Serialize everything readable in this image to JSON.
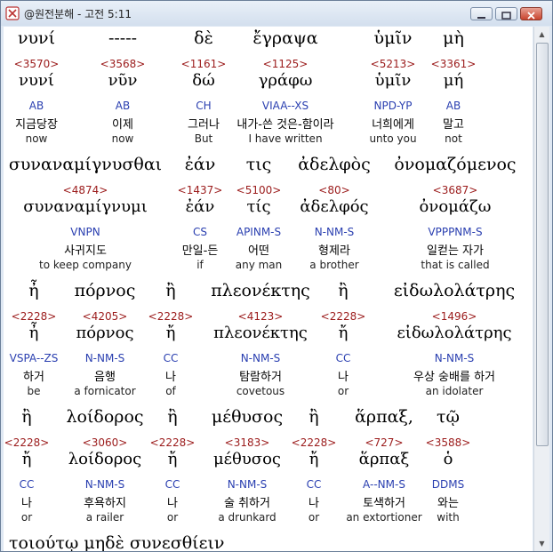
{
  "window": {
    "title": "@원전분해 - 고전 5:11"
  },
  "rows": [
    [
      {
        "word": "νυνί",
        "num": "<3570>",
        "lemma": "νυνί",
        "parse": "AB",
        "kor": "지금당장",
        "eng": "now"
      },
      {
        "word": "-----",
        "num": "<3568>",
        "lemma": "νῦν",
        "parse": "AB",
        "kor": "이제",
        "eng": "now"
      },
      {
        "word": "δὲ",
        "num": "<1161>",
        "lemma": "δώ",
        "parse": "CH",
        "kor": "그러나",
        "eng": "But"
      },
      {
        "word": "ἔγραψα",
        "num": "<1125>",
        "lemma": "γράφω",
        "parse": "VIAA--XS",
        "kor": "내가-쓴 것은-함이라",
        "eng": "I have written"
      },
      {
        "word": "ὑμῖν",
        "num": "<5213>",
        "lemma": "ὑμῖν",
        "parse": "NPD-YP",
        "kor": "너희에게",
        "eng": "unto you"
      },
      {
        "word": "μὴ",
        "num": "<3361>",
        "lemma": "μή",
        "parse": "AB",
        "kor": "말고",
        "eng": "not"
      }
    ],
    [
      {
        "word": "συναναμίγνυσθαι",
        "num": "<4874>",
        "lemma": "συναναμίγνυμι",
        "parse": "VNPN",
        "kor": "사귀지도",
        "eng": "to keep company"
      },
      {
        "word": "ἐάν",
        "num": "<1437>",
        "lemma": "ἐάν",
        "parse": "CS",
        "kor": "만일-든",
        "eng": "if"
      },
      {
        "word": "τις",
        "num": "<5100>",
        "lemma": "τίς",
        "parse": "APINM-S",
        "kor": "어떤",
        "eng": "any man"
      },
      {
        "word": "ἀδελφὸς",
        "num": "<80>",
        "lemma": "ἀδελφός",
        "parse": "N-NM-S",
        "kor": "형제라",
        "eng": "a brother"
      },
      {
        "word": "ὀνομαζόμενος",
        "num": "<3687>",
        "lemma": "ὀνομάζω",
        "parse": "VPPPNM-S",
        "kor": "일컫는 자가",
        "eng": "that is called"
      }
    ],
    [
      {
        "word": "ἦ",
        "num": "<2228>",
        "lemma": "ἦ",
        "parse": "VSPA--ZS",
        "kor": "하거",
        "eng": "be"
      },
      {
        "word": "πόρνος",
        "num": "<4205>",
        "lemma": "πόρνος",
        "parse": "N-NM-S",
        "kor": "음행",
        "eng": "a fornicator"
      },
      {
        "word": "ἢ",
        "num": "<2228>",
        "lemma": "ἤ",
        "parse": "CC",
        "kor": "나",
        "eng": "of"
      },
      {
        "word": "πλεονέκτης",
        "num": "<4123>",
        "lemma": "πλεονέκτης",
        "parse": "N-NM-S",
        "kor": "탐람하거",
        "eng": "covetous"
      },
      {
        "word": "ἢ",
        "num": "<2228>",
        "lemma": "ἤ",
        "parse": "CC",
        "kor": "나",
        "eng": "or"
      },
      {
        "word": "εἰδωλολάτρης",
        "num": "<1496>",
        "lemma": "εἰδωλολάτρης",
        "parse": "N-NM-S",
        "kor": "우상 숭배를 하거",
        "eng": "an idolater"
      }
    ],
    [
      {
        "word": "ἢ",
        "num": "<2228>",
        "lemma": "ἤ",
        "parse": "CC",
        "kor": "나",
        "eng": "or"
      },
      {
        "word": "λοίδορος",
        "num": "<3060>",
        "lemma": "λοίδορος",
        "parse": "N-NM-S",
        "kor": "후욕하지",
        "eng": "a railer"
      },
      {
        "word": "ἢ",
        "num": "<2228>",
        "lemma": "ἤ",
        "parse": "CC",
        "kor": "나",
        "eng": "or"
      },
      {
        "word": "μέθυσος",
        "num": "<3183>",
        "lemma": "μέθυσος",
        "parse": "N-NM-S",
        "kor": "술 취하거",
        "eng": "a drunkard"
      },
      {
        "word": "ἢ",
        "num": "<2228>",
        "lemma": "ἤ",
        "parse": "CC",
        "kor": "나",
        "eng": "or"
      },
      {
        "word": "ἅρπαξ,",
        "num": "<727>",
        "lemma": "ἅρπαξ",
        "parse": "A--NM-S",
        "kor": "토색하거",
        "eng": "an extortioner"
      },
      {
        "word": "τῷ",
        "num": "<3588>",
        "lemma": "ὁ",
        "parse": "DDMS",
        "kor": "와는",
        "eng": "with"
      }
    ]
  ],
  "partial_line": "τοιούτῳ  μηδὲ  συνεσθίειν"
}
